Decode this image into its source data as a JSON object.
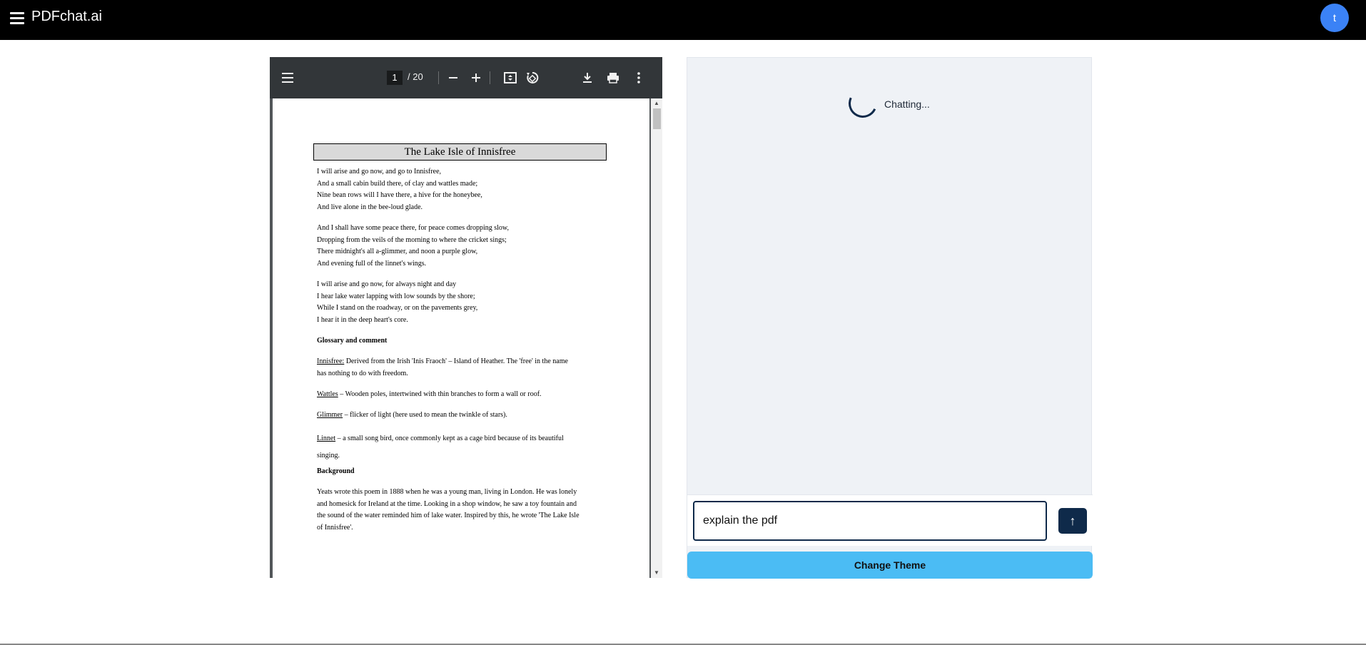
{
  "app": {
    "brand": "PDFchat.ai",
    "avatar_initial": "t"
  },
  "viewer": {
    "page_current": "1",
    "page_total": "/ 20"
  },
  "doc": {
    "title": "The Lake Isle of Innisfree",
    "stanza1": [
      "I will arise and go now, and go to Innisfree,",
      "And a small cabin build there, of clay and wattles made;",
      "Nine bean rows will I have there, a hive for the honeybee,",
      "And live alone in the bee-loud glade."
    ],
    "stanza2": [
      "And I shall have some peace there, for peace comes dropping slow,",
      "Dropping from the veils of the morning to where the cricket sings;",
      "There midnight's all a-glimmer, and noon a purple glow,",
      "And evening full of the linnet's wings."
    ],
    "stanza3": [
      "I will arise and go now, for always night and day",
      "I hear lake water lapping with low sounds by the shore;",
      "While I stand on the roadway, or on the pavements grey,",
      "I hear it in the deep heart's core."
    ],
    "glossary_heading": "Glossary and comment",
    "innisfree_term": "Innisfree:",
    "innisfree_def1": " Derived from the Irish 'Inis Fraoch' – Island of Heather.  The 'free' in the name",
    "innisfree_def2": "has nothing to do with freedom.",
    "wattles_term": "Wattles",
    "wattles_def": " – Wooden poles, intertwined with thin branches to form a wall or roof.",
    "glimmer_term": "Glimmer",
    "glimmer_def": " – flicker of light (here used to mean the twinkle of stars).",
    "linnet_term": "Linnet",
    "linnet_def1": " – a small song bird, once commonly kept as a cage bird because of its beautiful",
    "linnet_def2": "singing.",
    "background_heading": "Background",
    "background": [
      "Yeats wrote this poem in 1888 when he was a young man, living in London. He was lonely",
      "and homesick for Ireland at the time. Looking in a shop window, he saw a toy fountain and",
      "the sound of the water reminded him of lake water. Inspired by this, he wrote 'The Lake Isle",
      "of Innisfree'."
    ]
  },
  "chat": {
    "status": "Chatting...",
    "input_value": "explain the pdf",
    "send_label": "↑",
    "theme_button": "Change Theme"
  },
  "colors": {
    "accent": "#4bbcf4",
    "navy": "#0f2a4a",
    "avatar": "#3b82f6"
  }
}
